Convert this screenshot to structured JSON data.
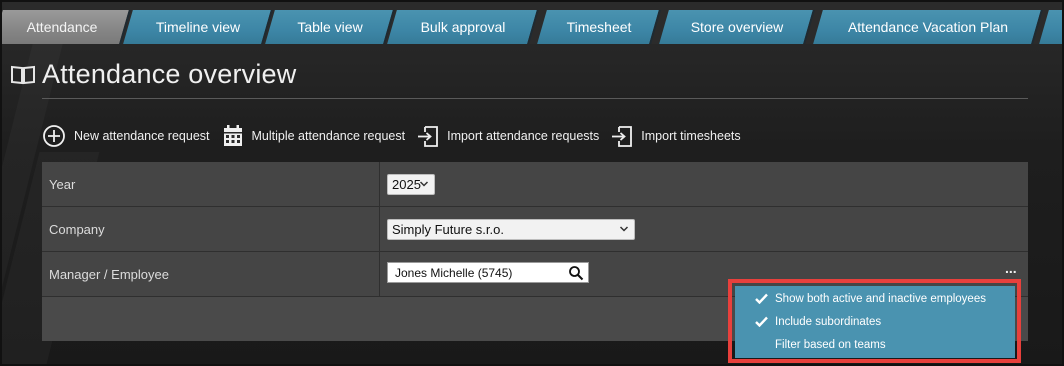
{
  "tabs": [
    {
      "label": "Attendance",
      "active": true
    },
    {
      "label": "Timeline view",
      "active": false
    },
    {
      "label": "Table view",
      "active": false
    },
    {
      "label": "Bulk approval",
      "active": false
    },
    {
      "label": "Timesheet",
      "active": false
    },
    {
      "label": "Store overview",
      "active": false
    },
    {
      "label": "Attendance Vacation Plan",
      "active": false
    }
  ],
  "page": {
    "title": "Attendance overview",
    "title_icon": "book-icon"
  },
  "toolbar": {
    "new_request": "New attendance request",
    "multiple_request": "Multiple attendance request",
    "import_requests": "Import attendance requests",
    "import_timesheets": "Import timesheets"
  },
  "filters": {
    "year": {
      "label": "Year",
      "value": "2025"
    },
    "company": {
      "label": "Company",
      "value": "Simply Future s.r.o."
    },
    "manager": {
      "label": "Manager / Employee",
      "value": "Jones Michelle (5745)"
    }
  },
  "options_menu": {
    "more_icon": "...",
    "items": [
      {
        "label": "Show both active and inactive employees",
        "checked": true
      },
      {
        "label": "Include subordinates",
        "checked": true
      },
      {
        "label": "Filter based on teams",
        "checked": false
      }
    ]
  },
  "colors": {
    "tab_blue": "#4a93b0",
    "tab_active_gray": "#858585",
    "popup_blue": "#4a93b0",
    "highlight_red": "#e8403c",
    "panel_row": "#454545"
  }
}
